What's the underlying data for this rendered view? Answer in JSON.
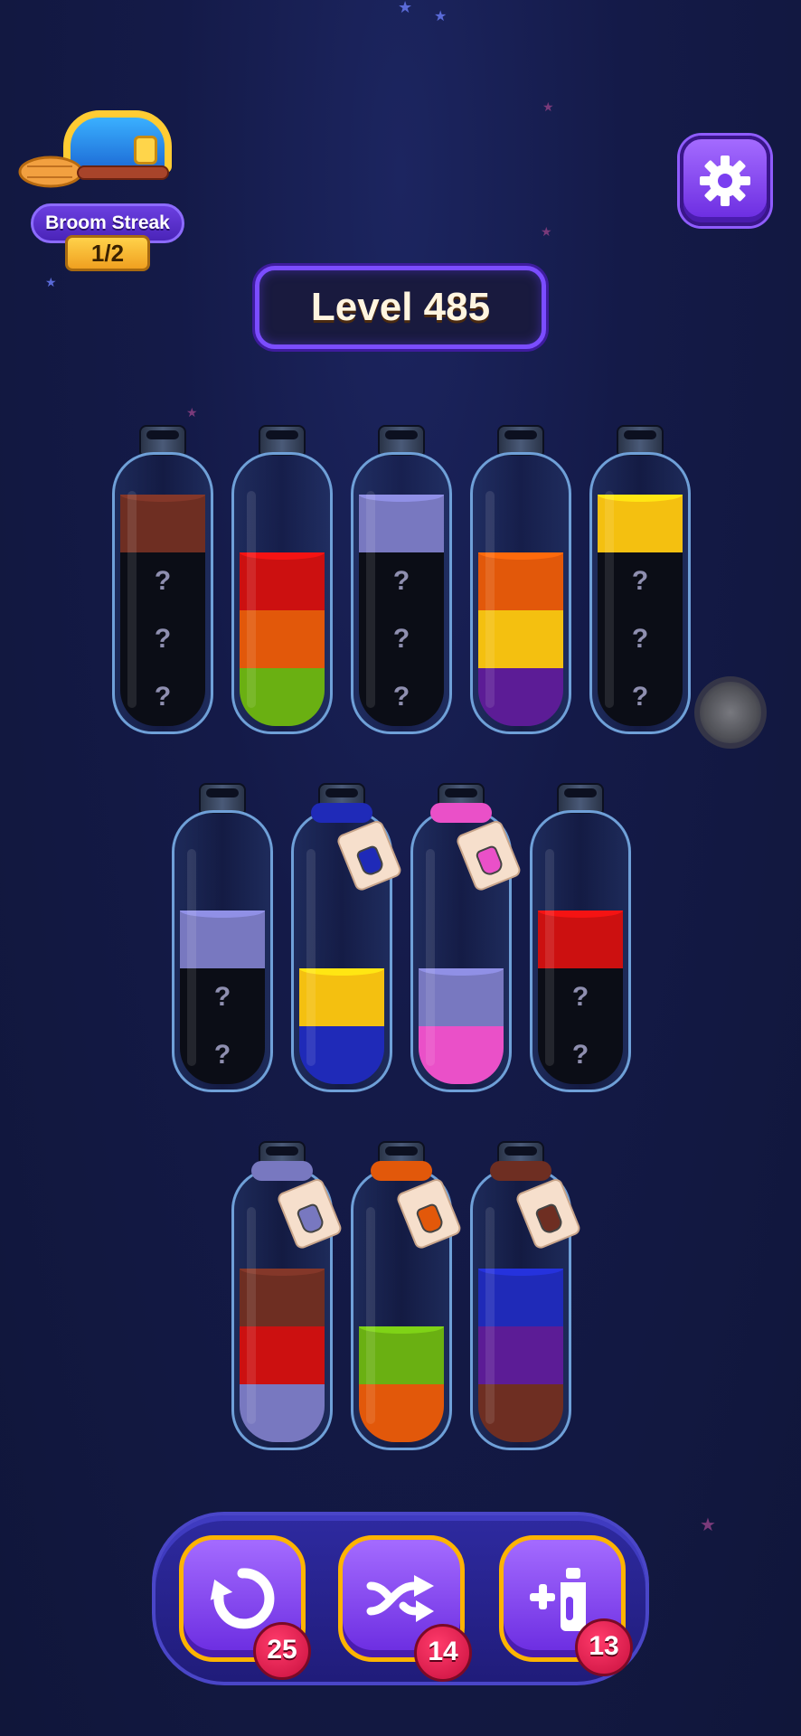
{
  "streak": {
    "label": "Broom Streak",
    "count": "1/2"
  },
  "level": {
    "title": "Level 485"
  },
  "hidden_marker": "?",
  "colors": {
    "brown": "#6e2e22",
    "red": "#cc1010",
    "orange": "#e2580a",
    "green": "#6ab012",
    "lavender": "#7878c0",
    "yellow": "#f4c010",
    "purple": "#5c1c96",
    "blue": "#1f2ab8",
    "pink": "#ea50c8",
    "hidden": "#0b0d16"
  },
  "bottles": [
    {
      "layers": [
        "hidden",
        "hidden",
        "hidden",
        "brown"
      ],
      "tag": null
    },
    {
      "layers": [
        "green",
        "orange",
        "red"
      ],
      "tag": null
    },
    {
      "layers": [
        "hidden",
        "hidden",
        "hidden",
        "lavender"
      ],
      "tag": null
    },
    {
      "layers": [
        "purple",
        "yellow",
        "orange"
      ],
      "tag": null
    },
    {
      "layers": [
        "hidden",
        "hidden",
        "hidden",
        "yellow"
      ],
      "tag": null
    },
    {
      "layers": [
        "hidden",
        "hidden",
        "lavender"
      ],
      "tag": null
    },
    {
      "layers": [
        "blue",
        "yellow"
      ],
      "tag": "blue"
    },
    {
      "layers": [
        "pink",
        "lavender"
      ],
      "tag": "pink"
    },
    {
      "layers": [
        "hidden",
        "hidden",
        "red"
      ],
      "tag": null
    },
    {
      "layers": [
        "lavender",
        "red",
        "brown"
      ],
      "tag": "lavender"
    },
    {
      "layers": [
        "orange",
        "green"
      ],
      "tag": "orange"
    },
    {
      "layers": [
        "brown",
        "purple",
        "blue"
      ],
      "tag": "brown"
    }
  ],
  "tools": {
    "undo": {
      "icon": "undo-icon",
      "count": "25"
    },
    "shuffle": {
      "icon": "shuffle-icon",
      "count": "14"
    },
    "add_bottle": {
      "icon": "add-bottle-icon",
      "count": "13"
    }
  }
}
